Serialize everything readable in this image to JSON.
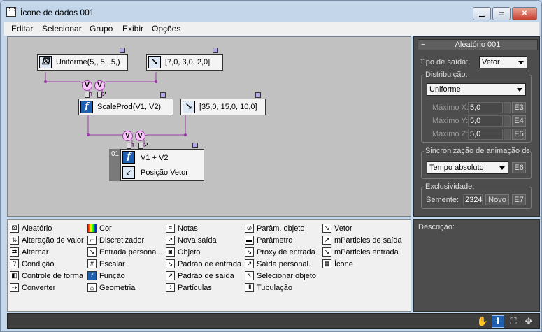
{
  "window": {
    "title": "Ícone de dados 001",
    "app_icon": "grid-icon"
  },
  "menu": [
    "Editar",
    "Selecionar",
    "Grupo",
    "Exibir",
    "Opções"
  ],
  "graph": {
    "nodes": {
      "uniform": "Uniforme(5,, 5,, 5,)",
      "vec1": "[7,0, 3,0, 2,0]",
      "scaleprod": "ScaleProd(V1, V2)",
      "vec2": "[35,0, 15,0, 10,0]",
      "output_line1": "V1 + V2",
      "output_line2": "Posição Vetor",
      "output_id": "01"
    },
    "v_label": "V",
    "port1": "1",
    "port2": "2"
  },
  "panel": {
    "title": "Aleatório 001",
    "collapse": "−",
    "tipo_label": "Tipo de saída:",
    "tipo_value": "Vetor",
    "distrib_label": "Distribuição:",
    "distrib_value": "Uniforme",
    "max_x_label": "Máximo X:",
    "max_x_value": "5,0",
    "max_x_btn": "E3",
    "max_y_label": "Máximo Y:",
    "max_y_value": "5,0",
    "max_y_btn": "E4",
    "max_z_label": "Máximo Z:",
    "max_z_value": "5,0",
    "max_z_btn": "E5",
    "sync_label": "Sincronização de animação de",
    "sync_value": "Tempo absoluto",
    "sync_btn": "E6",
    "excl_label": "Exclusividade:",
    "seed_label": "Semente:",
    "seed_value": "2324",
    "new_btn": "Novo",
    "seed_btn": "E7"
  },
  "depot": {
    "col1": [
      "Aleatório",
      "Alteração de valor",
      "Alternar",
      "Condição",
      "Controle de forma",
      "Converter"
    ],
    "col2": [
      "Cor",
      "Discretizador",
      "Entrada persona...",
      "Escalar",
      "Função",
      "Geometria"
    ],
    "col3": [
      "Notas",
      "Nova saída",
      "Objeto",
      "Padrão de entrada",
      "Padrão de saída",
      "Partículas"
    ],
    "col4": [
      "Parâm. objeto",
      "Parâmetro",
      "Proxy de entrada",
      "Saída personal.",
      "Selecionar objeto",
      "Tubulação"
    ],
    "col5": [
      "Vetor",
      "mParticles de saída",
      "mParticles entrada",
      "Ícone"
    ]
  },
  "description_label": "Descrição:",
  "status_icons": [
    "hand-icon",
    "info-icon",
    "select-icon",
    "move-icon"
  ]
}
